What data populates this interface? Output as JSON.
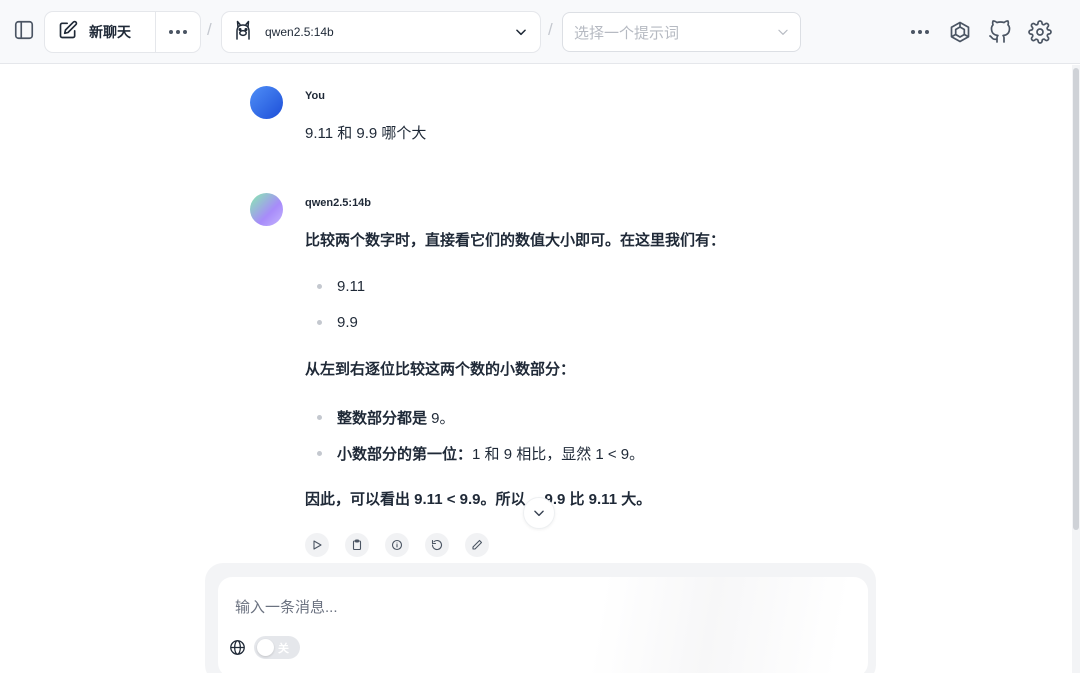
{
  "topbar": {
    "new_chat_label": "新聊天",
    "model_name": "qwen2.5:14b",
    "prompt_placeholder": "选择一个提示词"
  },
  "chat": {
    "user_message": {
      "sender": "You",
      "text": "9.11 和 9.9 哪个大"
    },
    "assistant_message": {
      "sender": "qwen2.5:14b",
      "intro": "比较两个数字时，直接看它们的数值大小即可。在这里我们有：",
      "numbers": [
        "9.11",
        "9.9"
      ],
      "step_heading": "从左到右逐位比较这两个数的小数部分：",
      "steps": [
        {
          "bold": "整数部分都是",
          "rest": " 9。"
        },
        {
          "bold": "小数部分的第一位：",
          "rest": "1 和 9 相比，显然 1 < 9。"
        }
      ],
      "conclusion_a": "因此，可以看出 9.11 < 9.9。所以",
      "conclusion_b": "9.9 比 9.11 大。"
    }
  },
  "composer": {
    "placeholder": "输入一条消息...",
    "web_search_toggle_label": "关",
    "web_search_enabled": false
  }
}
